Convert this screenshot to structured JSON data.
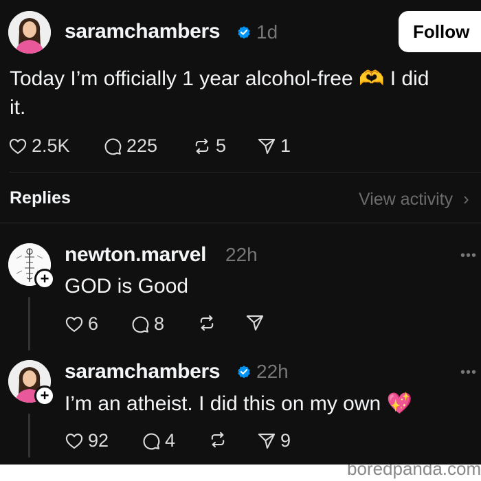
{
  "post": {
    "username": "saramchambers",
    "time": "1d",
    "follow_label": "Follow",
    "text_line1": "Today I’m officially 1 year alcohol-free",
    "text_emoji": "🫶",
    "text_after": "I did",
    "text_line2": "it.",
    "likes": "2.5K",
    "comments": "225",
    "reposts": "5",
    "shares": "1"
  },
  "replies_header": {
    "title": "Replies",
    "view_activity": "View activity",
    "chevron": "›"
  },
  "replies": [
    {
      "username": "newton.marvel",
      "time": "22h",
      "text": "GOD is Good",
      "likes": "6",
      "comments": "8",
      "reposts": "",
      "shares": "",
      "more": "•••",
      "plus": "+"
    },
    {
      "username": "saramchambers",
      "time": "22h",
      "text": "I’m an atheist. I did this on my own",
      "emoji": "💖",
      "likes": "92",
      "comments": "4",
      "reposts": "",
      "shares": "9",
      "more": "•••",
      "plus": "+"
    }
  ],
  "watermark": "boredpanda.com",
  "colors": {
    "background": "#101010",
    "verified": "#0095f6",
    "muted": "#777777"
  },
  "icons": [
    "heart-icon",
    "comment-icon",
    "repost-icon",
    "share-icon",
    "verified-icon",
    "plus-icon",
    "more-icon",
    "chevron-right-icon"
  ]
}
